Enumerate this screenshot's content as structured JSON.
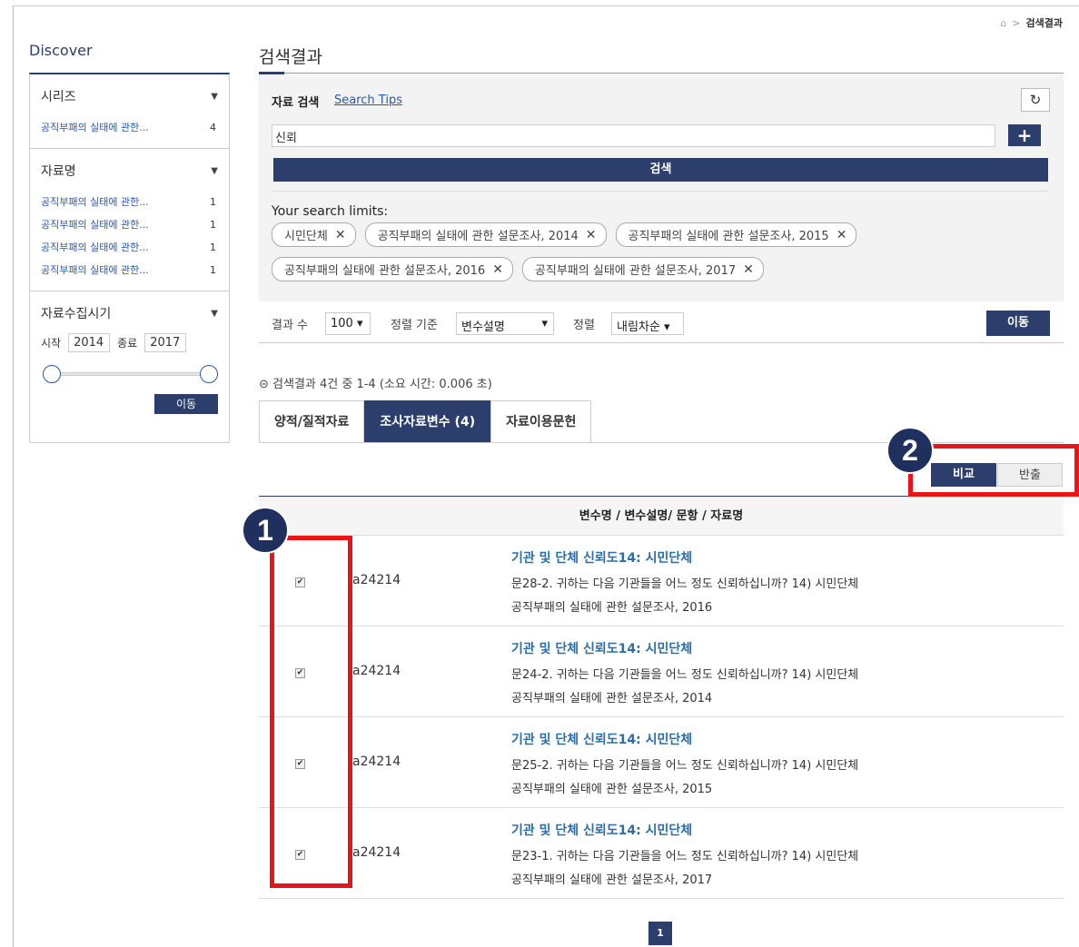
{
  "breadcrumb": {
    "current": "검색결과"
  },
  "sidebar": {
    "title": "Discover",
    "series": {
      "heading": "시리즈",
      "items": [
        {
          "label": "공직부패의 실태에 관한...",
          "count": "4"
        }
      ]
    },
    "dataname": {
      "heading": "자료명",
      "items": [
        {
          "label": "공직부패의 실태에 관한...",
          "count": "1"
        },
        {
          "label": "공직부패의 실태에 관한...",
          "count": "1"
        },
        {
          "label": "공직부패의 실태에 관한...",
          "count": "1"
        },
        {
          "label": "공직부패의 실태에 관한...",
          "count": "1"
        }
      ]
    },
    "period": {
      "heading": "자료수집시기",
      "start_label": "시작",
      "start": "2014",
      "end_label": "종료",
      "end": "2017",
      "go_label": "이동"
    }
  },
  "main": {
    "title": "검색결과",
    "search": {
      "label": "자료 검색",
      "tips": "Search Tips",
      "query": "신뢰",
      "search_button": "검색",
      "limits_label": "Your search limits:",
      "chips": [
        "시민단체",
        "공직부패의 실태에 관한 설문조사, 2014",
        "공직부패의 실태에 관한 설문조사, 2015",
        "공직부패의 실태에 관한 설문조사, 2016",
        "공직부패의 실태에 관한 설문조사, 2017"
      ]
    },
    "controls": {
      "count_label": "결과 수",
      "count_value": "100 ▾",
      "sort_label": "정렬 기준",
      "sort_value": "변수설명",
      "order_label": "정렬",
      "order_value": "내림차순 ▾",
      "go_label": "이동"
    },
    "result_info": "검색결과 4건 중 1-4 (소요 시간: 0.006 초)",
    "tabs": [
      "양적/질적자료",
      "조사자료변수 (4)",
      "자료이용문헌"
    ],
    "compare_label": "비교",
    "return_label": "반출",
    "table_header": "변수명 / 변수설명/ 문항 / 자료명",
    "rows": [
      {
        "code": "a24214",
        "title": "기관 및 단체 신뢰도14: 시민단체",
        "question": "문28-2. 귀하는 다음 기관들을 어느 정도 신뢰하십니까? 14) 시민단체",
        "dataset": "공직부패의 실태에 관한 설문조사, 2016",
        "checked": true
      },
      {
        "code": "a24214",
        "title": "기관 및 단체 신뢰도14: 시민단체",
        "question": "문24-2. 귀하는 다음 기관들을 어느 정도 신뢰하십니까? 14) 시민단체",
        "dataset": "공직부패의 실태에 관한 설문조사, 2014",
        "checked": true
      },
      {
        "code": "a24214",
        "title": "기관 및 단체 신뢰도14: 시민단체",
        "question": "문25-2. 귀하는 다음 기관들을 어느 정도 신뢰하십니까? 14) 시민단체",
        "dataset": "공직부패의 실태에 관한 설문조사, 2015",
        "checked": true
      },
      {
        "code": "a24214",
        "title": "기관 및 단체 신뢰도14: 시민단체",
        "question": "문23-1. 귀하는 다음 기관들을 어느 정도 신뢰하십니까? 14) 시민단체",
        "dataset": "공직부패의 실태에 관한 설문조사, 2017",
        "checked": true
      }
    ],
    "pagination": {
      "current": "1"
    }
  },
  "annotations": {
    "badge1": "1",
    "badge2": "2"
  },
  "colors": {
    "navy": "#2c3e6b",
    "link": "#2b57a8",
    "annotation_red": "#e8141a"
  },
  "icons": {
    "home": "home-icon",
    "refresh": "refresh-icon",
    "plus": "plus-icon",
    "info": "info-circle-icon",
    "chevron": "chevron-down-icon",
    "close": "close-icon"
  }
}
